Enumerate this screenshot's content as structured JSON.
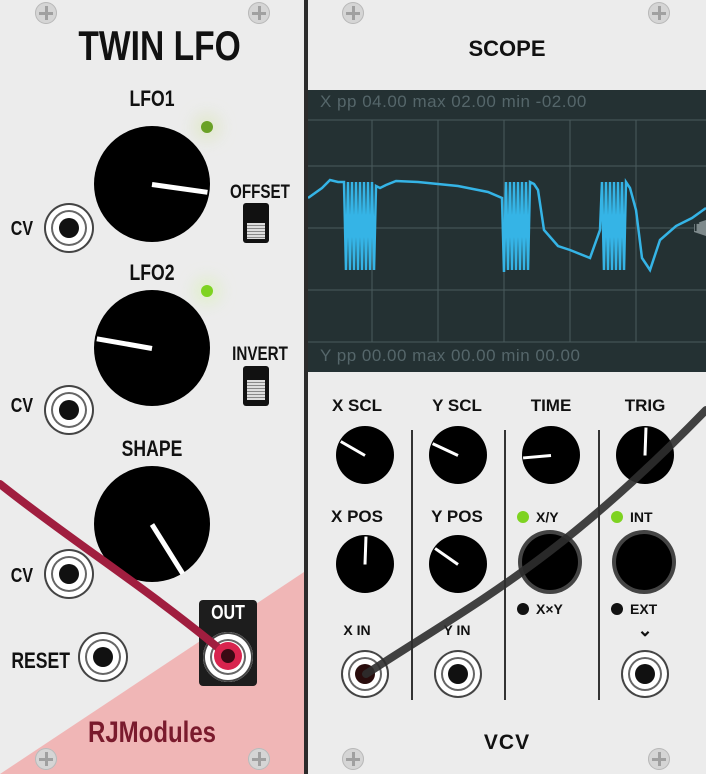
{
  "twin_lfo": {
    "title": "TWIN LFO",
    "lfo1_label": "LFO1",
    "lfo2_label": "LFO2",
    "shape_label": "SHAPE",
    "offset_label": "OFFSET",
    "invert_label": "INVERT",
    "cv_label": "CV",
    "reset_label": "RESET",
    "out_label": "OUT",
    "brand": "RJModules"
  },
  "scope": {
    "title": "SCOPE",
    "x_readout": "X   pp  04.00  max  02.00  min -02.00",
    "y_readout": "Y   pp  00.00  max  00.00  min  00.00",
    "trigger_marker": "T",
    "x_scl_label": "X SCL",
    "y_scl_label": "Y SCL",
    "time_label": "TIME",
    "trig_label": "TRIG",
    "x_pos_label": "X POS",
    "y_pos_label": "Y POS",
    "xy_label": "X/Y",
    "xtimesy_label": "X×Y",
    "int_label": "INT",
    "ext_label": "EXT",
    "x_in_label": "X IN",
    "y_in_label": "Y IN",
    "trig_in_arrow": "⌄",
    "brand": "VCV"
  },
  "colors": {
    "panel": "#ececec",
    "screen": "#243133",
    "trace": "#35b4e6",
    "led_green": "#7ed321",
    "red_cable": "#a01e3f",
    "dark_cable": "#2d2d2d",
    "pink_zone": "#f0b6b6"
  }
}
